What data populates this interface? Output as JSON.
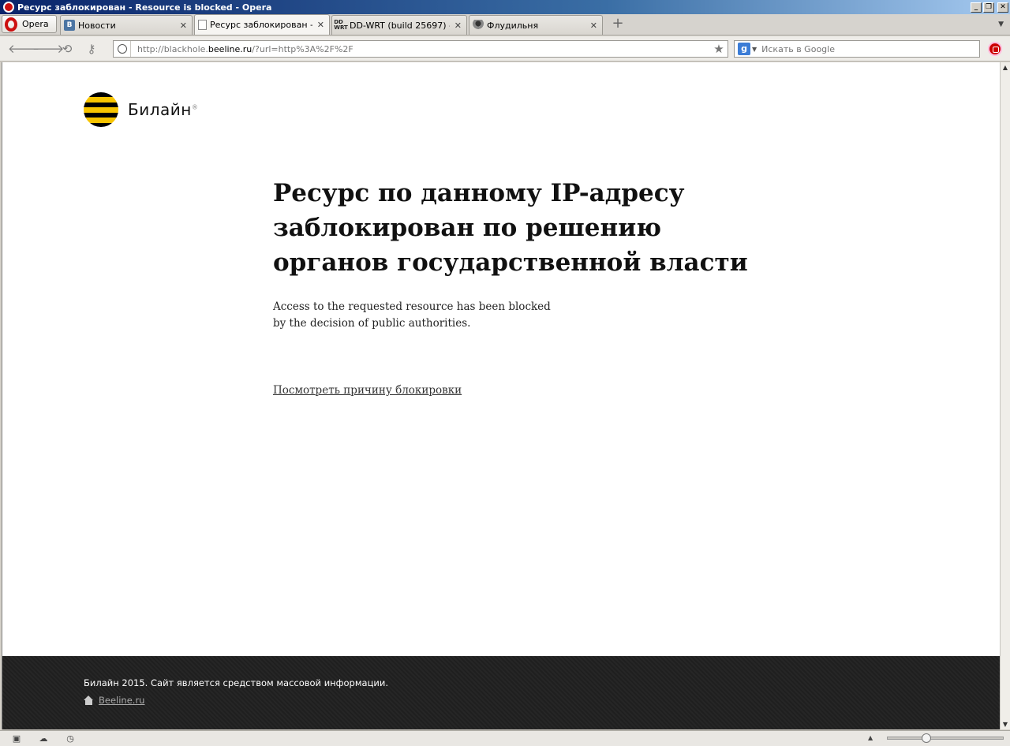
{
  "window": {
    "title": "Ресурс заблокирован - Resource is blocked - Opera",
    "controls": [
      "_",
      "❐",
      "✕"
    ]
  },
  "tabs": {
    "menu_label": "Opera",
    "items": [
      {
        "label": "Новости",
        "favicon": "vk-icon",
        "active": false
      },
      {
        "label": "Ресурс заблокирован - ...",
        "favicon": "page-icon",
        "active": true
      },
      {
        "label": "DD-WRT (build 25697) - ...",
        "favicon": "ddwrt-icon",
        "active": false
      },
      {
        "label": "Флудильня",
        "favicon": "user-icon",
        "active": false
      }
    ]
  },
  "toolbar": {
    "url_prefix": "http://blackhole.",
    "url_domain": "beeline.ru",
    "url_suffix": "/?url=http%3A%2F%2F",
    "search_placeholder": "Искать в Google"
  },
  "page": {
    "brand": "Билайн",
    "headline_lines": [
      "Ресурс по данному IP-адресу",
      "заблокирован по решению",
      "органов государственной власти"
    ],
    "english_lines": [
      "Access to the requested resource has been blocked",
      "by the decision of public authorities."
    ],
    "reason_link": "Посмотреть причину блокировки",
    "footer_copyright": "Билайн 2015. Сайт является средством массовой информации.",
    "footer_link": "Beeline.ru"
  },
  "colors": {
    "brand_yellow": "#f7c400",
    "footer_bg": "#232323",
    "opera_red": "#cc1010"
  },
  "statusbar": {
    "zoom_fraction": 0.32
  }
}
